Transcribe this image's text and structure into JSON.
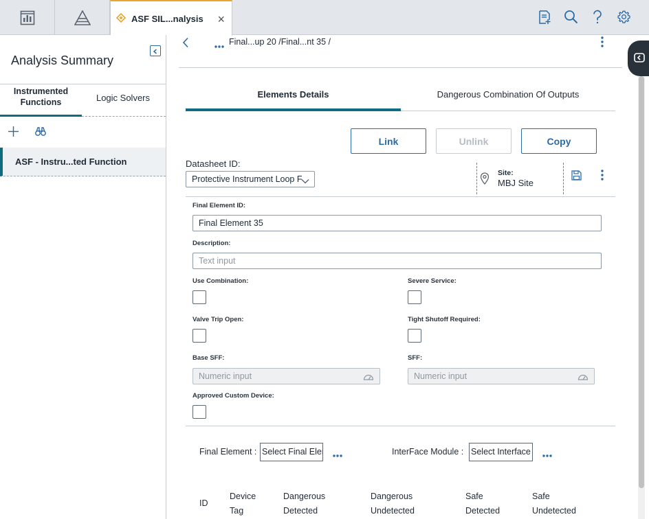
{
  "topbar": {
    "home_icon": "dashboard-icon",
    "pyramid_icon": "pyramid-icon",
    "tab_icon": "diamond-icon",
    "tab_label": "ASF SIL...nalysis",
    "close_glyph": "×",
    "right_icons": [
      "report-add-icon",
      "search-icon",
      "help-icon",
      "gear-icon"
    ],
    "accent_color": "#e8a530",
    "icon_color": "#2c6aa6"
  },
  "left_panel": {
    "title": "Analysis Summary",
    "tabs": [
      {
        "label": "Instrumented Functions",
        "active": true
      },
      {
        "label": "Logic Solvers",
        "active": false
      }
    ],
    "toolbar_icons": [
      "add-icon",
      "binoculars-icon"
    ],
    "items": [
      {
        "label": "ASF - Instru...ted Function",
        "selected": true
      }
    ]
  },
  "main": {
    "breadcrumb": "Final...up 20 /Final...nt 35 /",
    "detail_tabs": [
      {
        "label": "Elements Details",
        "active": true
      },
      {
        "label": "Dangerous Combination Of Outputs",
        "active": false
      }
    ],
    "buttons": {
      "link": "Link",
      "unlink": "Unlink",
      "copy": "Copy"
    },
    "datasheet": {
      "label": "Datasheet ID:",
      "value": "Protective Instrument Loop F"
    },
    "site": {
      "label": "Site:",
      "value": "MBJ Site"
    },
    "fields": {
      "final_element_id": {
        "label": "Final Element ID:",
        "value": "Final Element 35"
      },
      "description": {
        "label": "Description:",
        "placeholder": "Text input"
      },
      "use_combination": {
        "label": "Use Combination:",
        "checked": false
      },
      "severe_service": {
        "label": "Severe Service:",
        "checked": false
      },
      "valve_trip_open": {
        "label": "Valve Trip Open:",
        "checked": false
      },
      "tight_shutoff": {
        "label": "Tight Shutoff Required:",
        "checked": false
      },
      "base_sff": {
        "label": "Base SFF:",
        "placeholder": "Numeric input"
      },
      "sff": {
        "label": "SFF:",
        "placeholder": "Numeric input"
      },
      "approved_custom_device": {
        "label": "Approved Custom Device:",
        "checked": false
      }
    },
    "selectors": {
      "final_element_label": "Final Element :",
      "final_element_value": "Select Final Elen",
      "interface_label": "InterFace Module :",
      "interface_value": "Select Interface"
    },
    "table_headers": [
      [
        "ID"
      ],
      [
        "Device",
        "Tag"
      ],
      [
        "Dangerous",
        "Detected"
      ],
      [
        "Dangerous",
        "Undetected"
      ],
      [
        "Safe",
        "Detected"
      ],
      [
        "Safe",
        "Undetected"
      ]
    ]
  }
}
